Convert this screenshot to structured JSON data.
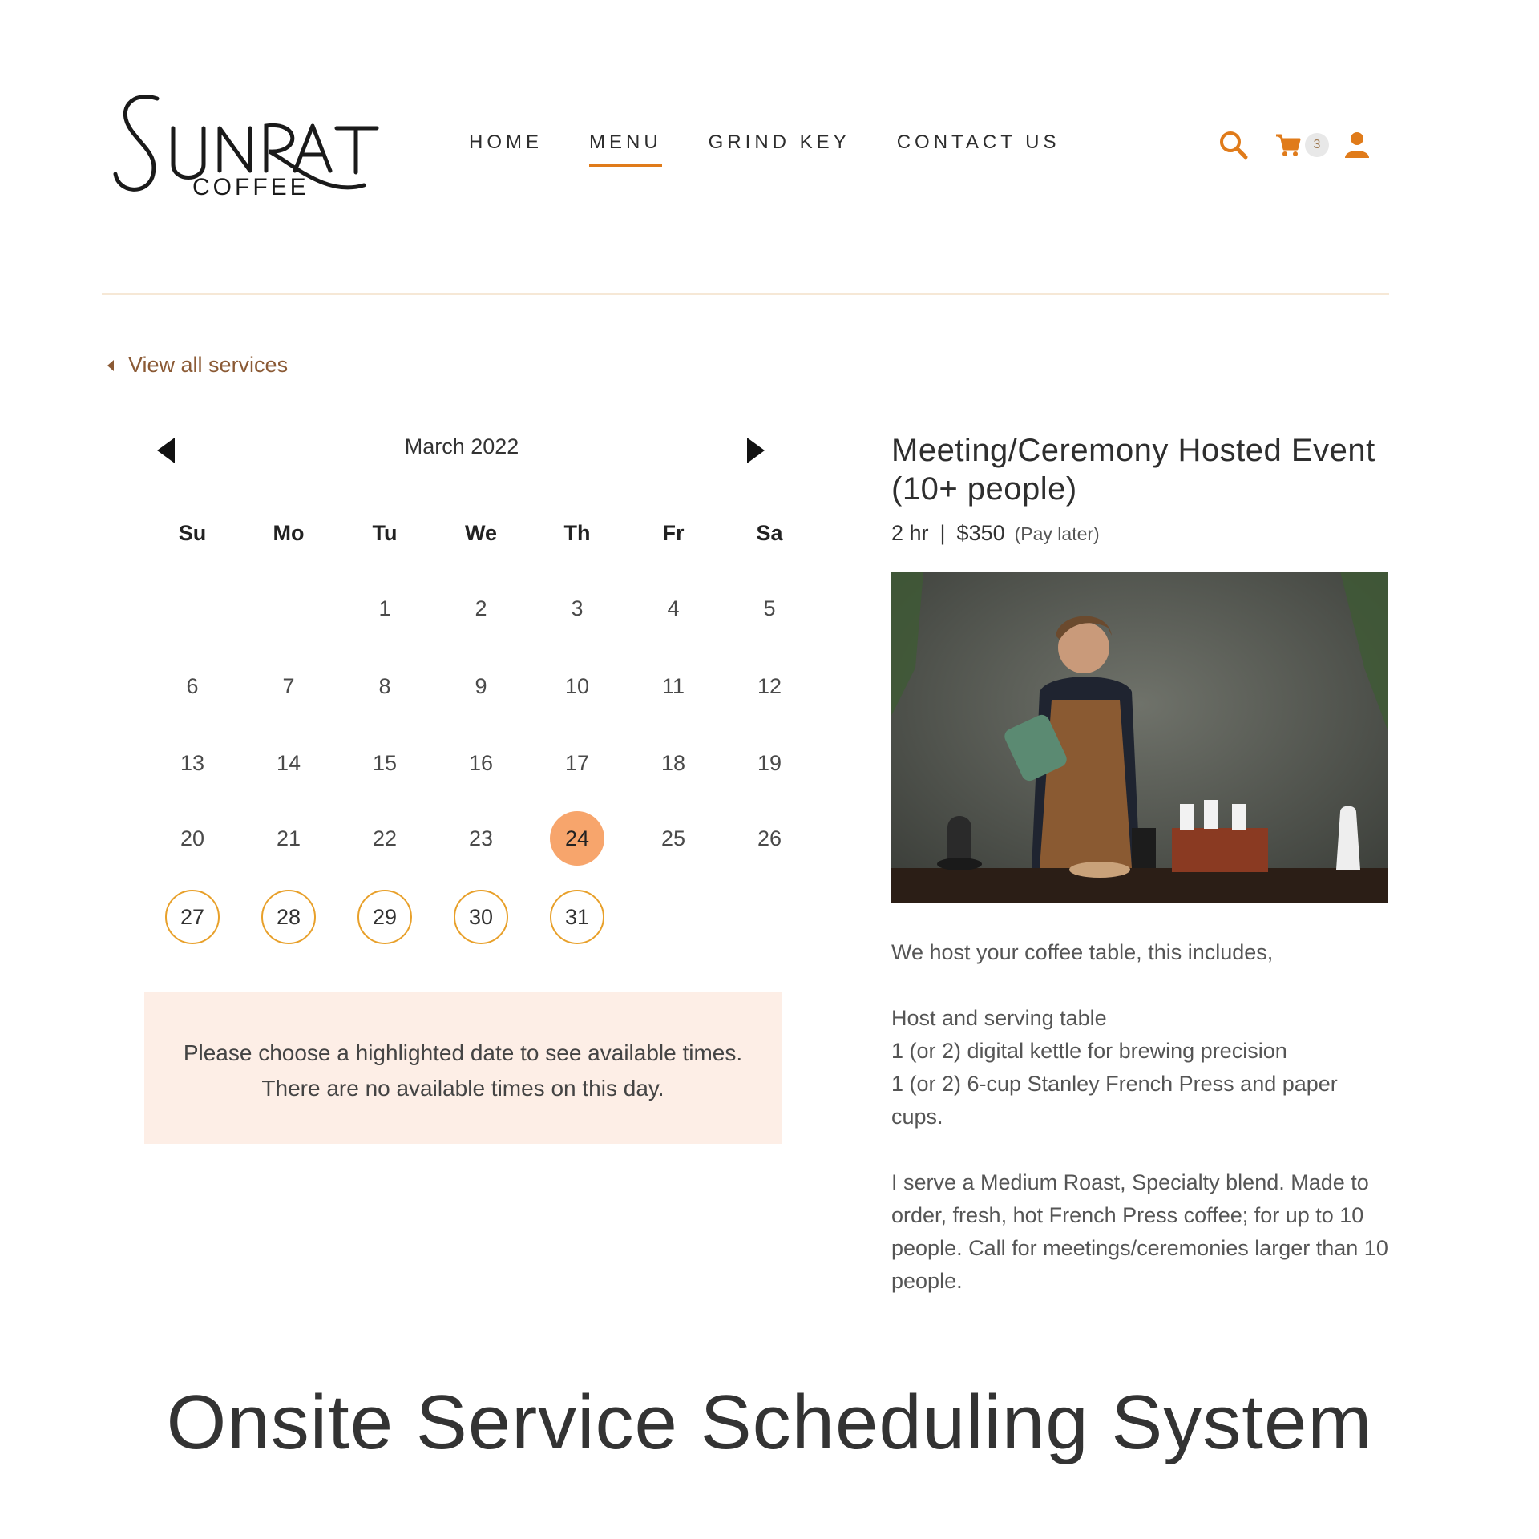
{
  "brand": {
    "logo_text": "SUNRAT",
    "logo_subtext": "COFFEE"
  },
  "nav": {
    "items": [
      {
        "label": "HOME",
        "active": false
      },
      {
        "label": "MENU",
        "active": true
      },
      {
        "label": "GRIND KEY",
        "active": false
      },
      {
        "label": "CONTACT US",
        "active": false
      }
    ]
  },
  "header_icons": {
    "search": "search-icon",
    "cart": "cart-icon",
    "cart_count": "3",
    "account": "user-icon",
    "accent": "#e07b1a"
  },
  "back_link": {
    "label": "View all services"
  },
  "calendar": {
    "month_label": "March 2022",
    "weekdays": [
      "Su",
      "Mo",
      "Tu",
      "We",
      "Th",
      "Fr",
      "Sa"
    ],
    "first_weekday_index": 2,
    "days_in_month": 31,
    "selected_day": 24,
    "available_days": [
      27,
      28,
      29,
      30,
      31
    ],
    "selected_color": "#f7a56c",
    "available_ring_color": "#e8a02a",
    "notice_lines": [
      "Please choose a highlighted date to see available times.",
      "There are no available times on this day."
    ]
  },
  "service": {
    "title": "Meeting/Ceremony Hosted Event (10+ people)",
    "duration": "2 hr",
    "separator": "|",
    "price": "$350",
    "payment_note": "(Pay later)",
    "description": {
      "intro": "We host your coffee table, this includes,",
      "items": [
        "Host and serving table",
        "1 (or 2) digital kettle for brewing precision",
        "1 (or 2) 6-cup Stanley French Press and paper cups."
      ],
      "closing": "I serve a Medium Roast, Specialty blend. Made to order, fresh, hot French Press coffee; for up to 10 people. Call for meetings/ceremonies larger than 10 people."
    }
  },
  "caption": "Onsite Service Scheduling System"
}
